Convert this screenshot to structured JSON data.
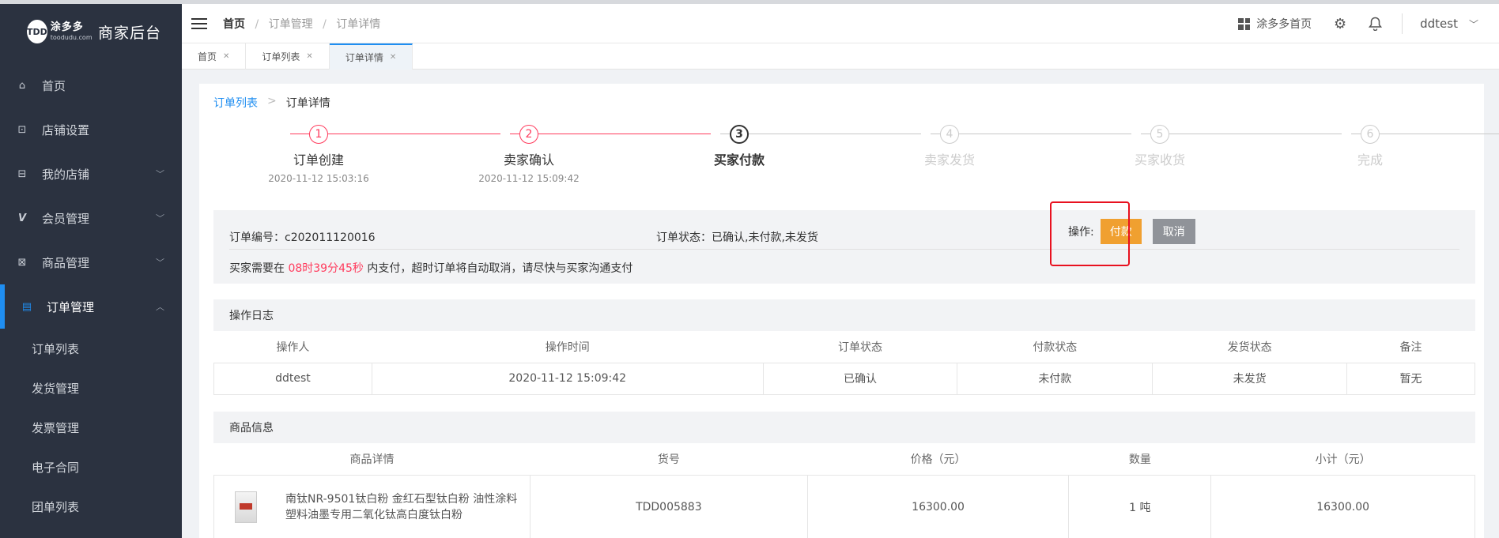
{
  "sidebar": {
    "logo_cn": "涂多多",
    "logo_en": "toodudu.com",
    "logo_mark": "TDD",
    "brand_title": "商家后台",
    "items": [
      {
        "label": "首页",
        "icon": "home-icon"
      },
      {
        "label": "店铺设置",
        "icon": "store-icon"
      },
      {
        "label": "我的店铺",
        "icon": "shop-icon"
      },
      {
        "label": "会员管理",
        "icon": "member-icon"
      },
      {
        "label": "商品管理",
        "icon": "goods-icon"
      },
      {
        "label": "订单管理",
        "icon": "order-icon"
      }
    ],
    "sub_items": [
      "订单列表",
      "发货管理",
      "发票管理",
      "电子合同",
      "团单列表"
    ]
  },
  "header": {
    "breadcrumb": [
      "首页",
      "订单管理",
      "订单详情"
    ],
    "home_link": "涂多多首页",
    "username": "ddtest"
  },
  "tabs": [
    "首页",
    "订单列表",
    "订单详情"
  ],
  "page_breadcrumb": {
    "link": "订单列表",
    "current": "订单详情"
  },
  "steps": [
    {
      "num": "1",
      "name": "订单创建",
      "time": "2020-11-12 15:03:16"
    },
    {
      "num": "2",
      "name": "卖家确认",
      "time": "2020-11-12 15:09:42"
    },
    {
      "num": "3",
      "name": "买家付款",
      "time": ""
    },
    {
      "num": "4",
      "name": "卖家发货",
      "time": ""
    },
    {
      "num": "5",
      "name": "买家收货",
      "time": ""
    },
    {
      "num": "6",
      "name": "完成",
      "time": ""
    }
  ],
  "order": {
    "number_label": "订单编号：",
    "number": "c202011120016",
    "status_label": "订单状态：",
    "status": "已确认,未付款,未发货",
    "op_label": "操作:",
    "pay_button": "付款",
    "cancel_button": "取消",
    "notice_prefix": "买家需要在",
    "countdown": "08时39分45秒",
    "notice_suffix": "内支付，超时订单将自动取消，请尽快与买家沟通支付"
  },
  "log": {
    "title": "操作日志",
    "headers": [
      "操作人",
      "操作时间",
      "订单状态",
      "付款状态",
      "发货状态",
      "备注"
    ],
    "rows": [
      [
        "ddtest",
        "2020-11-12 15:09:42",
        "已确认",
        "未付款",
        "未发货",
        "暂无"
      ]
    ]
  },
  "goods": {
    "title": "商品信息",
    "headers": [
      "商品详情",
      "货号",
      "价格（元）",
      "数量",
      "小计（元）"
    ],
    "rows": [
      {
        "name": "南钛NR-9501钛白粉 金红石型钛白粉 油性涂料塑料油墨专用二氧化钛高白度钛白粉",
        "sku": "TDD005883",
        "price": "16300.00",
        "qty": "1 吨",
        "subtotal": "16300.00"
      }
    ]
  },
  "colors": {
    "accent": "#1f8ef1",
    "done": "#ff3a5c",
    "pay": "#f0a030",
    "highlight": "#e8111f"
  }
}
